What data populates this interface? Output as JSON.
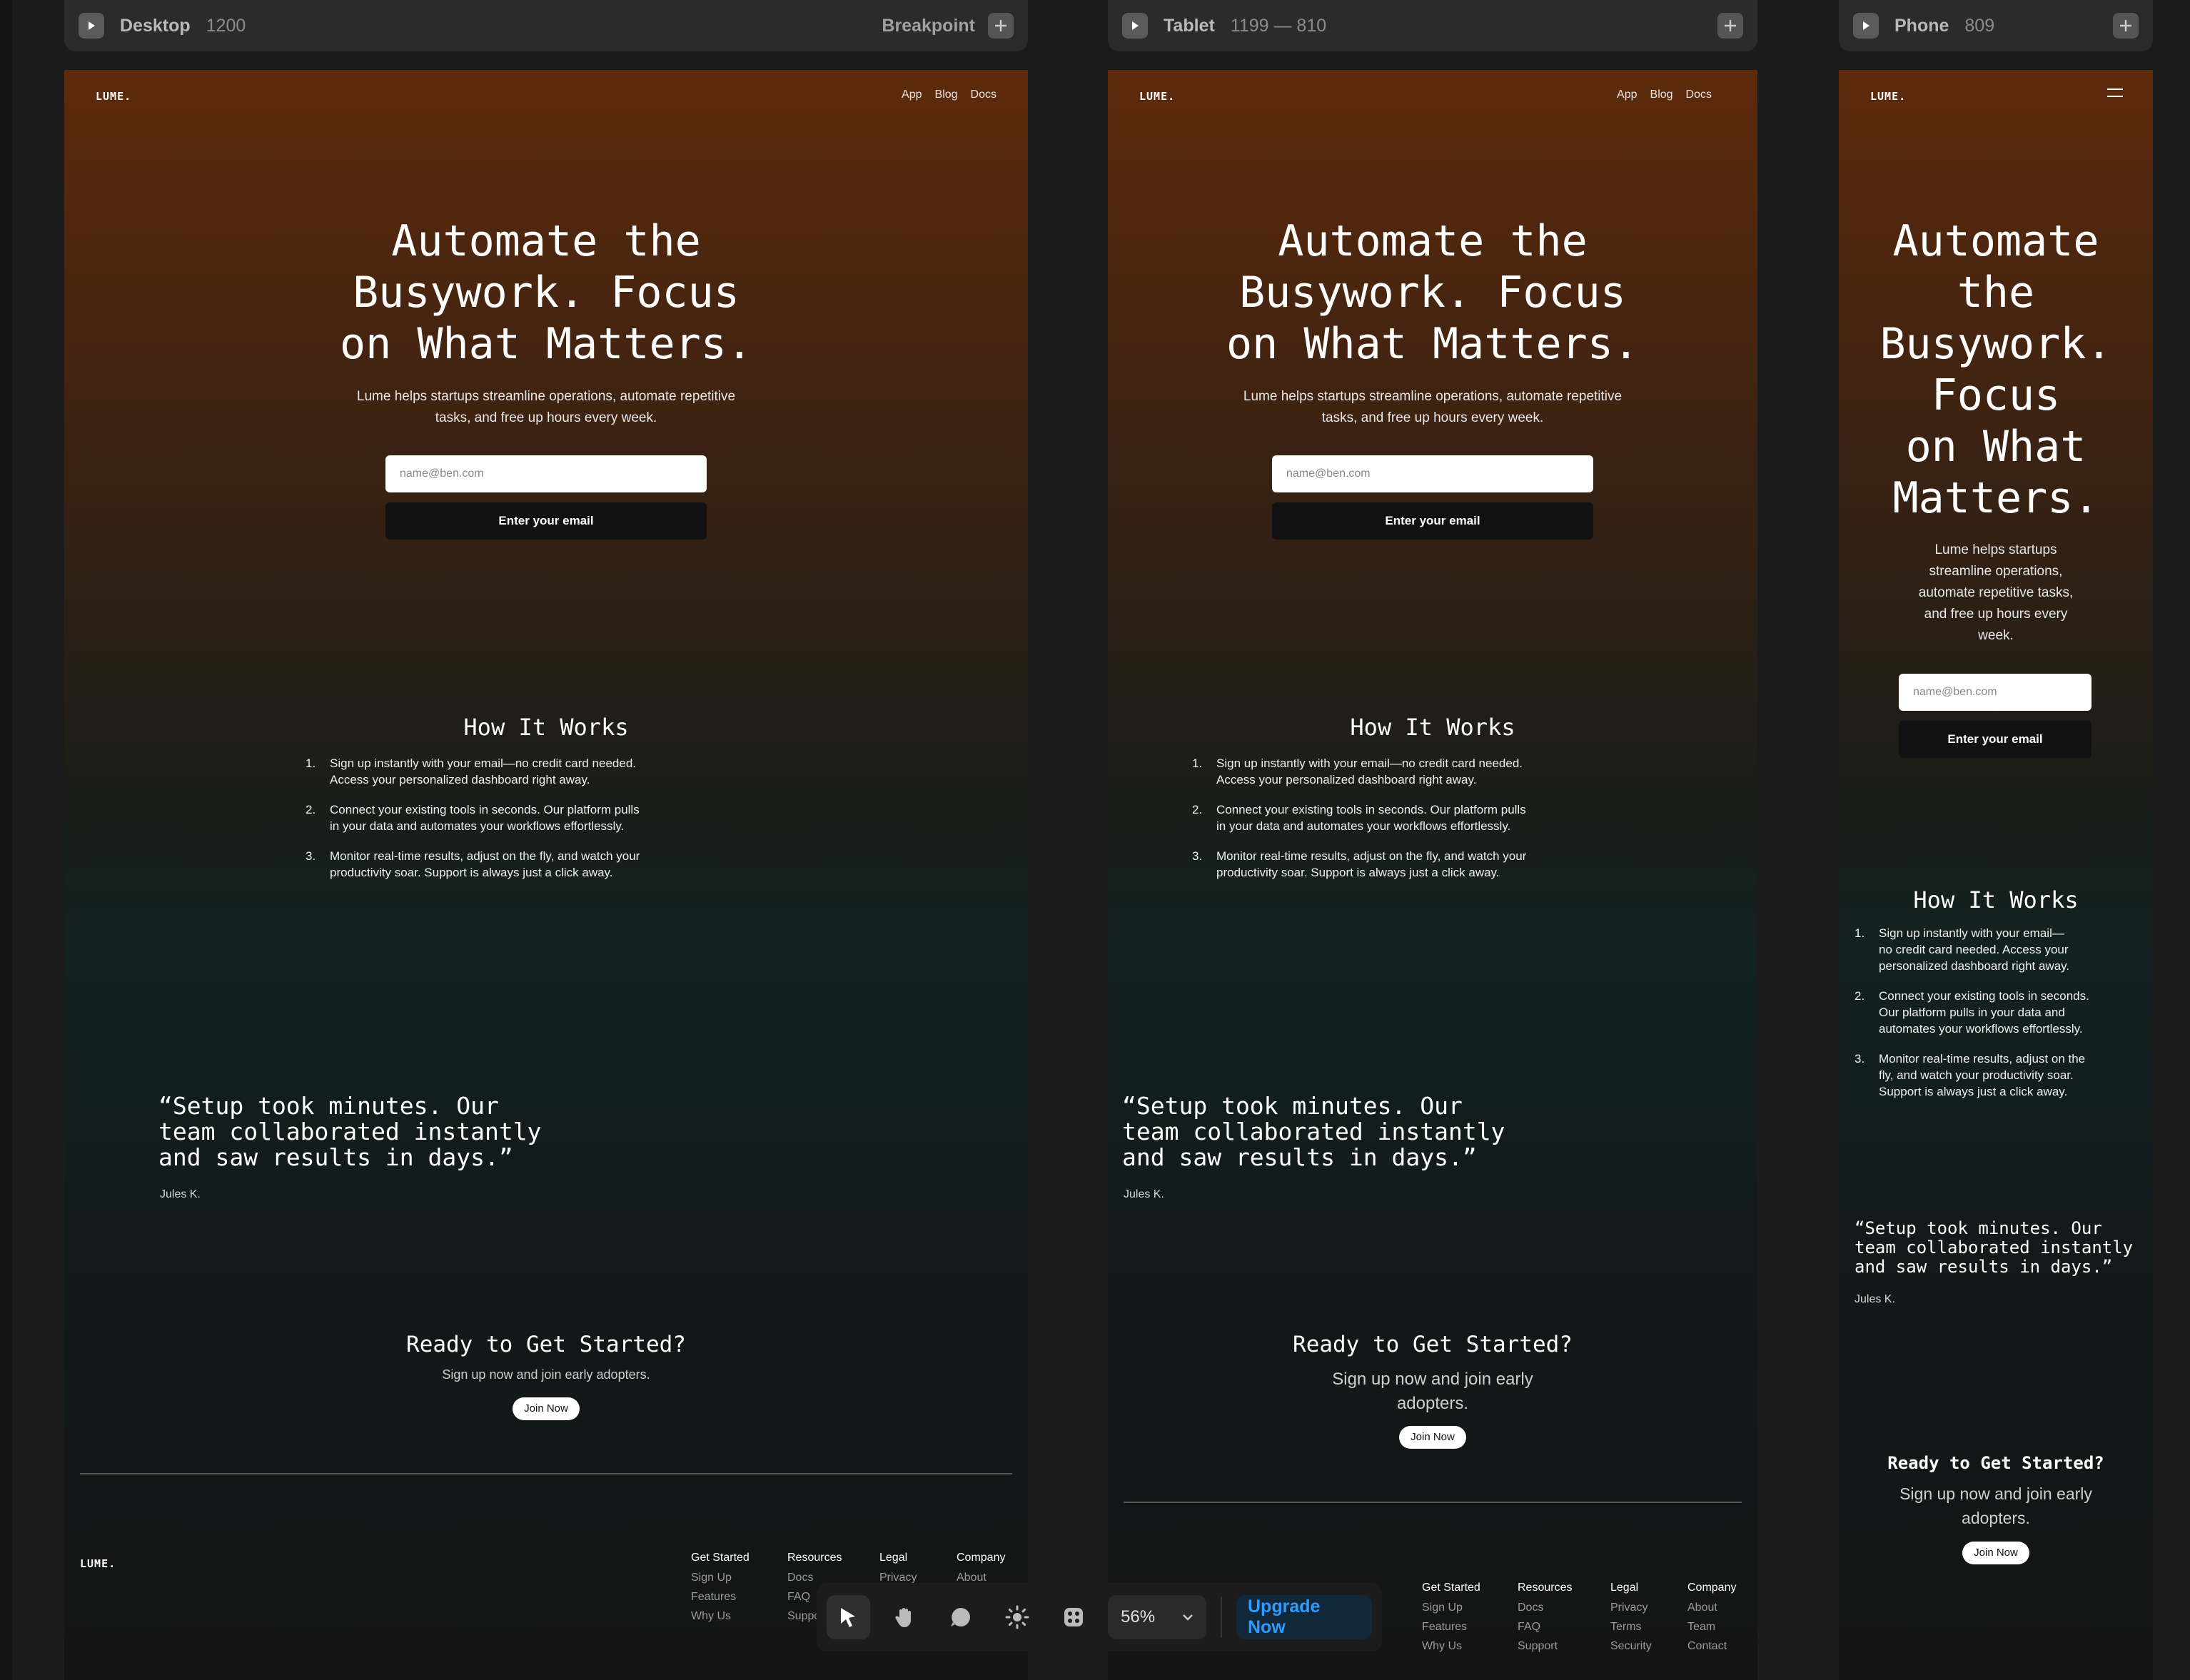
{
  "frames": {
    "desktop": {
      "name": "Desktop",
      "size": "1200",
      "breakpoint_label": "Breakpoint"
    },
    "tablet": {
      "name": "Tablet",
      "size": "1199 — 810"
    },
    "phone": {
      "name": "Phone",
      "size": "809"
    }
  },
  "site": {
    "logo": "LUME.",
    "nav": [
      "App",
      "Blog",
      "Docs"
    ],
    "hero": {
      "title_desktop": [
        "Automate the",
        "Busywork. Focus",
        "on What Matters."
      ],
      "title_phone": [
        "Automate",
        "the",
        "Busywork.",
        "Focus",
        "on What",
        "Matters."
      ],
      "subtitle_desktop": [
        "Lume helps startups streamline operations, automate repetitive",
        "tasks, and free up hours every week."
      ],
      "subtitle_phone": [
        "Lume helps startups",
        "streamline operations,",
        "automate repetitive tasks,",
        "and free up hours every",
        "week."
      ],
      "email_placeholder": "name@ben.com",
      "cta": "Enter your email"
    },
    "how": {
      "title": "How It Works",
      "steps_desktop": [
        [
          "Sign up instantly with your email—no credit card needed.",
          "Access your personalized dashboard right away."
        ],
        [
          "Connect your existing tools in seconds. Our platform pulls",
          "in your data and automates your workflows effortlessly."
        ],
        [
          "Monitor real-time results, adjust on the fly, and watch your",
          "productivity soar. Support is always just a click away."
        ]
      ],
      "steps_phone": [
        [
          "Sign up instantly with your email—",
          "no credit card needed. Access your",
          "personalized dashboard right away."
        ],
        [
          "Connect your existing tools in seconds.",
          "Our platform pulls in your data and",
          "automates your workflows effortlessly."
        ],
        [
          "Monitor real-time results, adjust on the",
          "fly, and watch your productivity soar.",
          "Support is always just a click away."
        ]
      ]
    },
    "testimonial": {
      "quote": [
        "“Setup took minutes. Our",
        "team collaborated instantly",
        "and saw results in days.”"
      ],
      "author": "Jules K."
    },
    "ready": {
      "title": "Ready to Get Started?",
      "subtitle": "Sign up now and join early adopters.",
      "subtitle_wrapped": [
        "Sign up now and join early",
        "adopters."
      ],
      "button": "Join Now"
    },
    "footer": {
      "columns": [
        {
          "heading": "Get Started",
          "items": [
            "Sign Up",
            "Features",
            "Why Us"
          ]
        },
        {
          "heading": "Resources",
          "items": [
            "Docs",
            "FAQ",
            "Support"
          ]
        },
        {
          "heading": "Legal",
          "items": [
            "Privacy",
            "Terms",
            "Security"
          ]
        },
        {
          "heading": "Company",
          "items": [
            "About",
            "Team",
            "Contact"
          ]
        }
      ]
    }
  },
  "toolbar": {
    "tools": [
      "select-tool",
      "hand-tool",
      "comment-tool",
      "theme-tool",
      "plugins-tool"
    ],
    "zoom": "56%",
    "upgrade": "Upgrade Now"
  }
}
